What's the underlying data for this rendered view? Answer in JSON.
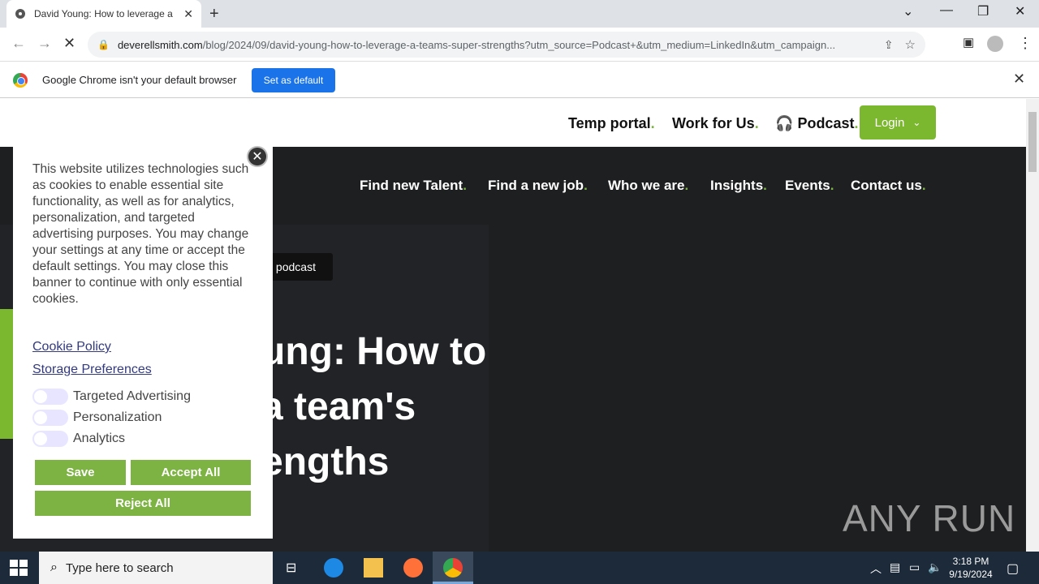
{
  "browser": {
    "tab_title": "David Young: How to leverage a",
    "url_host": "deverellsmith.com",
    "url_path": "/blog/2024/09/david-young-how-to-leverage-a-teams-super-strengths?utm_source=Podcast+&utm_medium=LinkedIn&utm_campaign...",
    "infobar_message": "Google Chrome isn't your default browser",
    "set_default_label": "Set as default"
  },
  "site": {
    "top_nav": [
      "Temp portal",
      "Work for Us",
      "Podcast"
    ],
    "login_label": "Login",
    "main_nav": [
      "Find new Talent",
      "Find a new job",
      "Who we are",
      "Insights",
      "Events",
      "Contact us"
    ],
    "nav_dot": ".",
    "tag": "y podcast",
    "headline_lines": [
      "ung: How to",
      "a team's",
      "engths"
    ]
  },
  "cookie": {
    "body": "This website utilizes technologies such as cookies to enable essential site functionality, as well as for analytics, personalization, and targeted advertising purposes. You may change your settings at any time or accept the default settings. You may close this banner to continue with only essential cookies.",
    "policy_link": "Cookie Policy",
    "prefs_link": "Storage Preferences",
    "toggles": [
      "Targeted Advertising",
      "Personalization",
      "Analytics"
    ],
    "toggle_states": [
      false,
      false,
      false
    ],
    "save_label": "Save",
    "accept_label": "Accept All",
    "reject_label": "Reject All"
  },
  "watermark": "ANY RUN",
  "taskbar": {
    "search_placeholder": "Type here to search",
    "time": "3:18 PM",
    "date": "9/19/2024"
  },
  "colors": {
    "accent_green": "#7cb82f",
    "chrome_blue": "#1a73e8",
    "hero_dark": "#1e1f21"
  }
}
